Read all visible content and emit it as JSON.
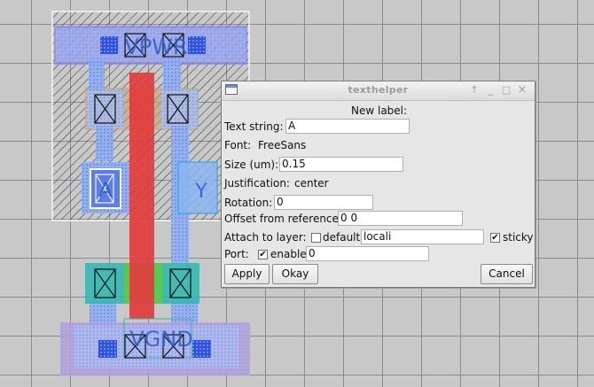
{
  "layout": {
    "labels": {
      "power": "VPWR",
      "ground": "VGND",
      "input": "A",
      "output": "Y"
    }
  },
  "dialog": {
    "title": "texthelper",
    "titlebar_buttons": [
      "↑",
      "_",
      "□",
      "×"
    ],
    "heading": "New label:",
    "text_string": {
      "label": "Text string:",
      "value": "A"
    },
    "font": {
      "label": "Font:",
      "value": "FreeSans"
    },
    "size": {
      "label": "Size (um):",
      "value": "0.15"
    },
    "justification": {
      "label": "Justification:",
      "value": "center"
    },
    "rotation": {
      "label": "Rotation:",
      "value": "0"
    },
    "offset": {
      "label": "Offset from reference:",
      "value": "0 0"
    },
    "attach": {
      "label": "Attach to layer:",
      "default_label": "default",
      "default_checked": false,
      "layer_value": "locali",
      "sticky_label": "sticky",
      "sticky_checked": true
    },
    "port": {
      "label": "Port:",
      "enable_label": "enable",
      "enable_checked": true,
      "value": "0"
    },
    "buttons": {
      "apply": "Apply",
      "okay": "Okay",
      "cancel": "Cancel"
    }
  },
  "colors": {
    "metal": "#6f8ff0",
    "poly": "#e23c3c",
    "diffusion": "#2bb8b0",
    "nwell_hatch": "#333333",
    "contact": "#1f3fd8"
  }
}
